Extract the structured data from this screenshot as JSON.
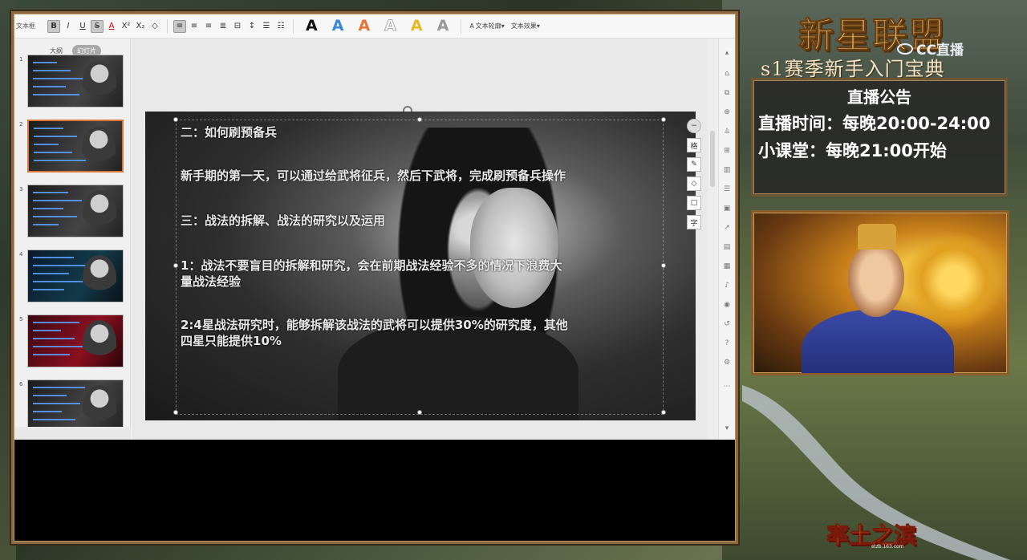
{
  "toolbar": {
    "font_box": "文本框",
    "bold": "B",
    "italic": "I",
    "underline": "U",
    "strike": "S",
    "font_color": "A",
    "superscript": "X²",
    "subscript": "X₂",
    "clear": "◇",
    "text_styles": [
      "A",
      "A",
      "A",
      "A",
      "A",
      "A"
    ],
    "text_style_colors": [
      "#111111",
      "#3a86d8",
      "#e8733a",
      "#bbbbbb",
      "#e8b820",
      "#999999"
    ],
    "text_outline": "文本轮廓",
    "text_effects": "文本效果"
  },
  "thumb_pane": {
    "tabs": [
      "大纲",
      "幻灯片"
    ],
    "slides": [
      {
        "num": "1"
      },
      {
        "num": "2"
      },
      {
        "num": "3"
      },
      {
        "num": "4"
      },
      {
        "num": "5"
      },
      {
        "num": "6"
      }
    ],
    "selected_index": 1
  },
  "slide": {
    "lines": [
      "二：如何刷预备兵",
      "新手期的第一天，可以通过给武将征兵，然后下武将，完成刷预备兵操作",
      "三：战法的拆解、战法的研究以及运用",
      "1：战法不要盲目的拆解和研究，会在前期战法经验不多的情况下浪费大\n量战法经验",
      "2:4星战法研究时，能够拆解该战法的武将可以提供30%的研究度，其他\n四星只能提供10%"
    ]
  },
  "float_tools": [
    "−",
    "格",
    "✎",
    "◇",
    "□",
    "字"
  ],
  "overlay": {
    "brand_title": "新星联盟",
    "cc_logo": "CC直播",
    "subtitle": "s1赛季新手入门宝典",
    "notice_title": "直播公告",
    "notice_lines": [
      "直播时间：每晚20:00-24:00",
      "小课堂：每晚21:00开始"
    ],
    "game_logo": "率土之滨",
    "game_logo_url": "stzb.163.com"
  }
}
